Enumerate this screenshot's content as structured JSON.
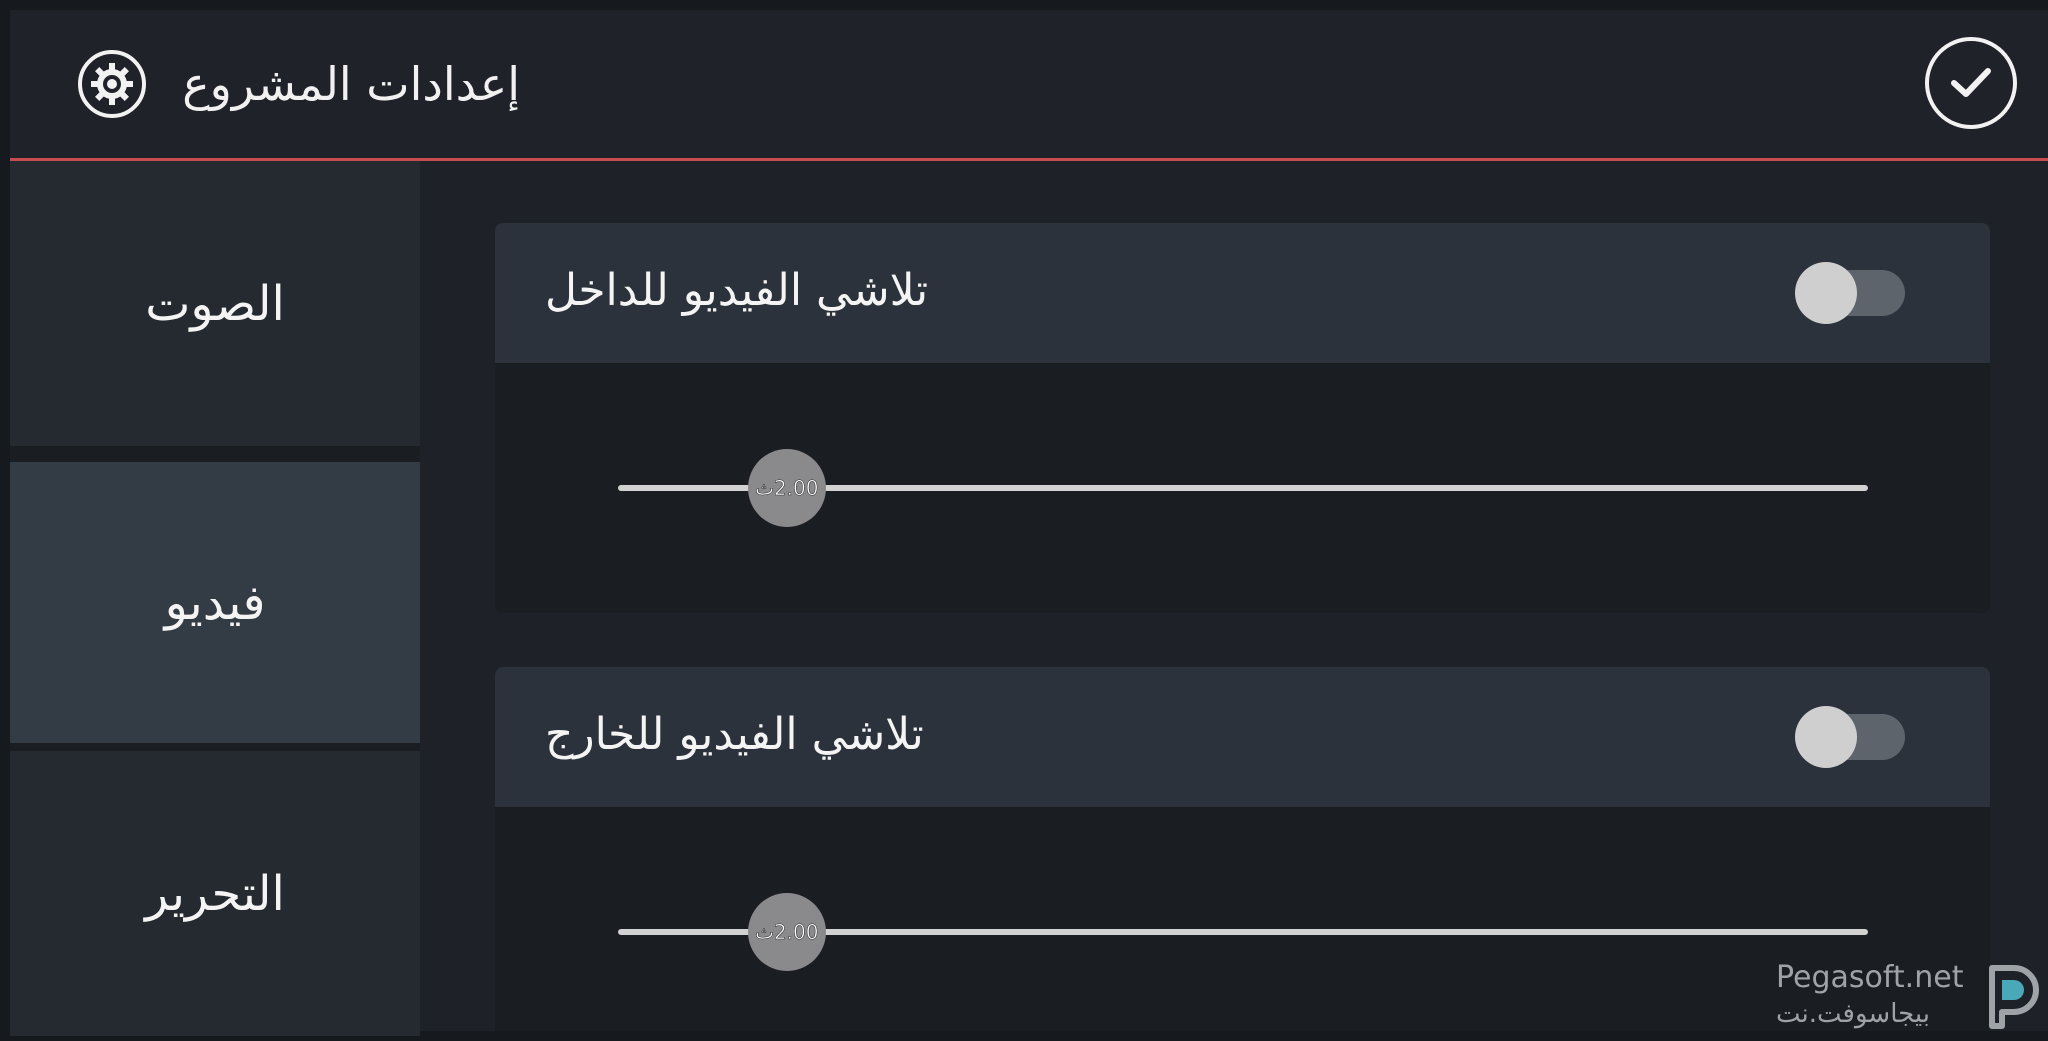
{
  "header": {
    "title": "إعدادات المشروع",
    "gear_icon": "settings-gear-icon",
    "confirm_icon": "check-icon"
  },
  "sidebar": {
    "items": [
      {
        "label": "الصوت",
        "active": false
      },
      {
        "label": "فيديو",
        "active": true
      },
      {
        "label": "التحرير",
        "active": false
      }
    ]
  },
  "settings": {
    "fade_in": {
      "title": "تلاشي الفيديو للداخل",
      "enabled": false,
      "value_label": "2.00ث",
      "slider_fraction": 0.135
    },
    "fade_out": {
      "title": "تلاشي الفيديو للخارج",
      "enabled": false,
      "value_label": "2.00ث",
      "slider_fraction": 0.135
    }
  },
  "watermark": {
    "latin": "Pegasoft.net",
    "arabic": "بيجاسوفت.نت"
  },
  "colors": {
    "accent_line": "#c84b4f",
    "active_tab": "#333b44",
    "card_header": "#2b323b"
  }
}
